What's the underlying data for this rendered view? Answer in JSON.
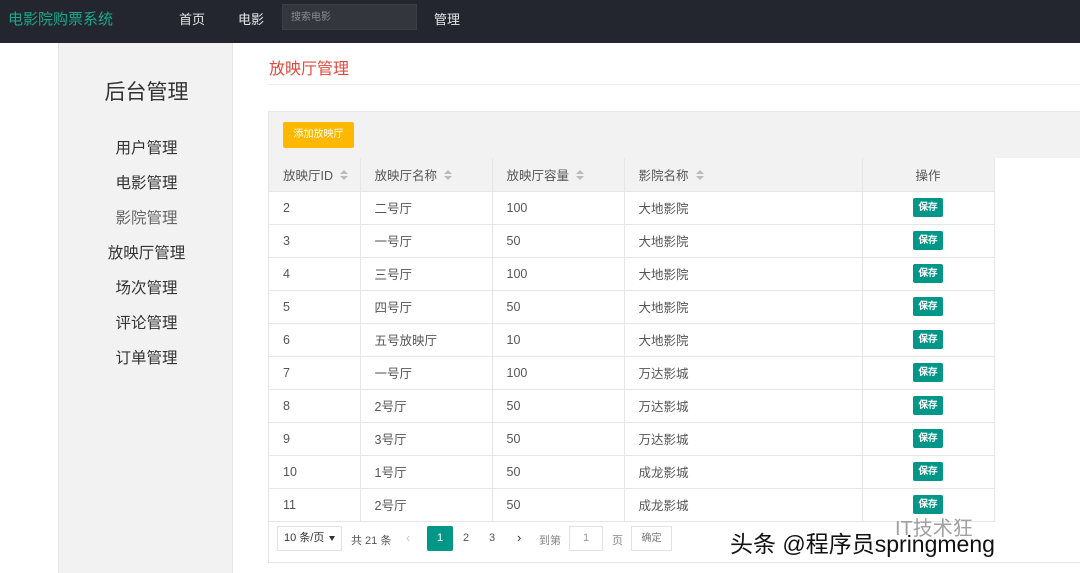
{
  "navbar": {
    "brand": "电影院购票系统",
    "links": [
      "首页",
      "电影"
    ],
    "search_placeholder": "搜索电影",
    "manage": "管理"
  },
  "sidebar": {
    "title": "后台管理",
    "items": [
      "用户管理",
      "电影管理",
      "影院管理",
      "放映厅管理",
      "场次管理",
      "评论管理",
      "订单管理"
    ]
  },
  "page": {
    "title": "放映厅管理",
    "add_button": "添加放映厅"
  },
  "table": {
    "columns": [
      "放映厅ID",
      "放映厅名称",
      "放映厅容量",
      "影院名称",
      "操作"
    ],
    "action_label": "保存",
    "rows": [
      [
        "2",
        "二号厅",
        "100",
        "大地影院"
      ],
      [
        "3",
        "一号厅",
        "50",
        "大地影院"
      ],
      [
        "4",
        "三号厅",
        "100",
        "大地影院"
      ],
      [
        "5",
        "四号厅",
        "50",
        "大地影院"
      ],
      [
        "6",
        "五号放映厅",
        "10",
        "大地影院"
      ],
      [
        "7",
        "一号厅",
        "100",
        "万达影城"
      ],
      [
        "8",
        "2号厅",
        "50",
        "万达影城"
      ],
      [
        "9",
        "3号厅",
        "50",
        "万达影城"
      ],
      [
        "10",
        "1号厅",
        "50",
        "成龙影城"
      ],
      [
        "11",
        "2号厅",
        "50",
        "成龙影城"
      ]
    ]
  },
  "pager": {
    "limit": "10 条/页",
    "total": "共 21 条",
    "pages": [
      "1",
      "2",
      "3"
    ],
    "current_page": "1",
    "goto_label": "到第",
    "goto_value": "1",
    "page_unit": "页",
    "confirm": "确定"
  },
  "watermark": {
    "text": "头条 @程序员springmeng",
    "logo_text": "IT技术狂"
  },
  "colors": {
    "navbar": "#23262e",
    "brand": "#19a88d",
    "title": "#e0483e",
    "accent": "#009688",
    "add_button": "#ffb800"
  }
}
